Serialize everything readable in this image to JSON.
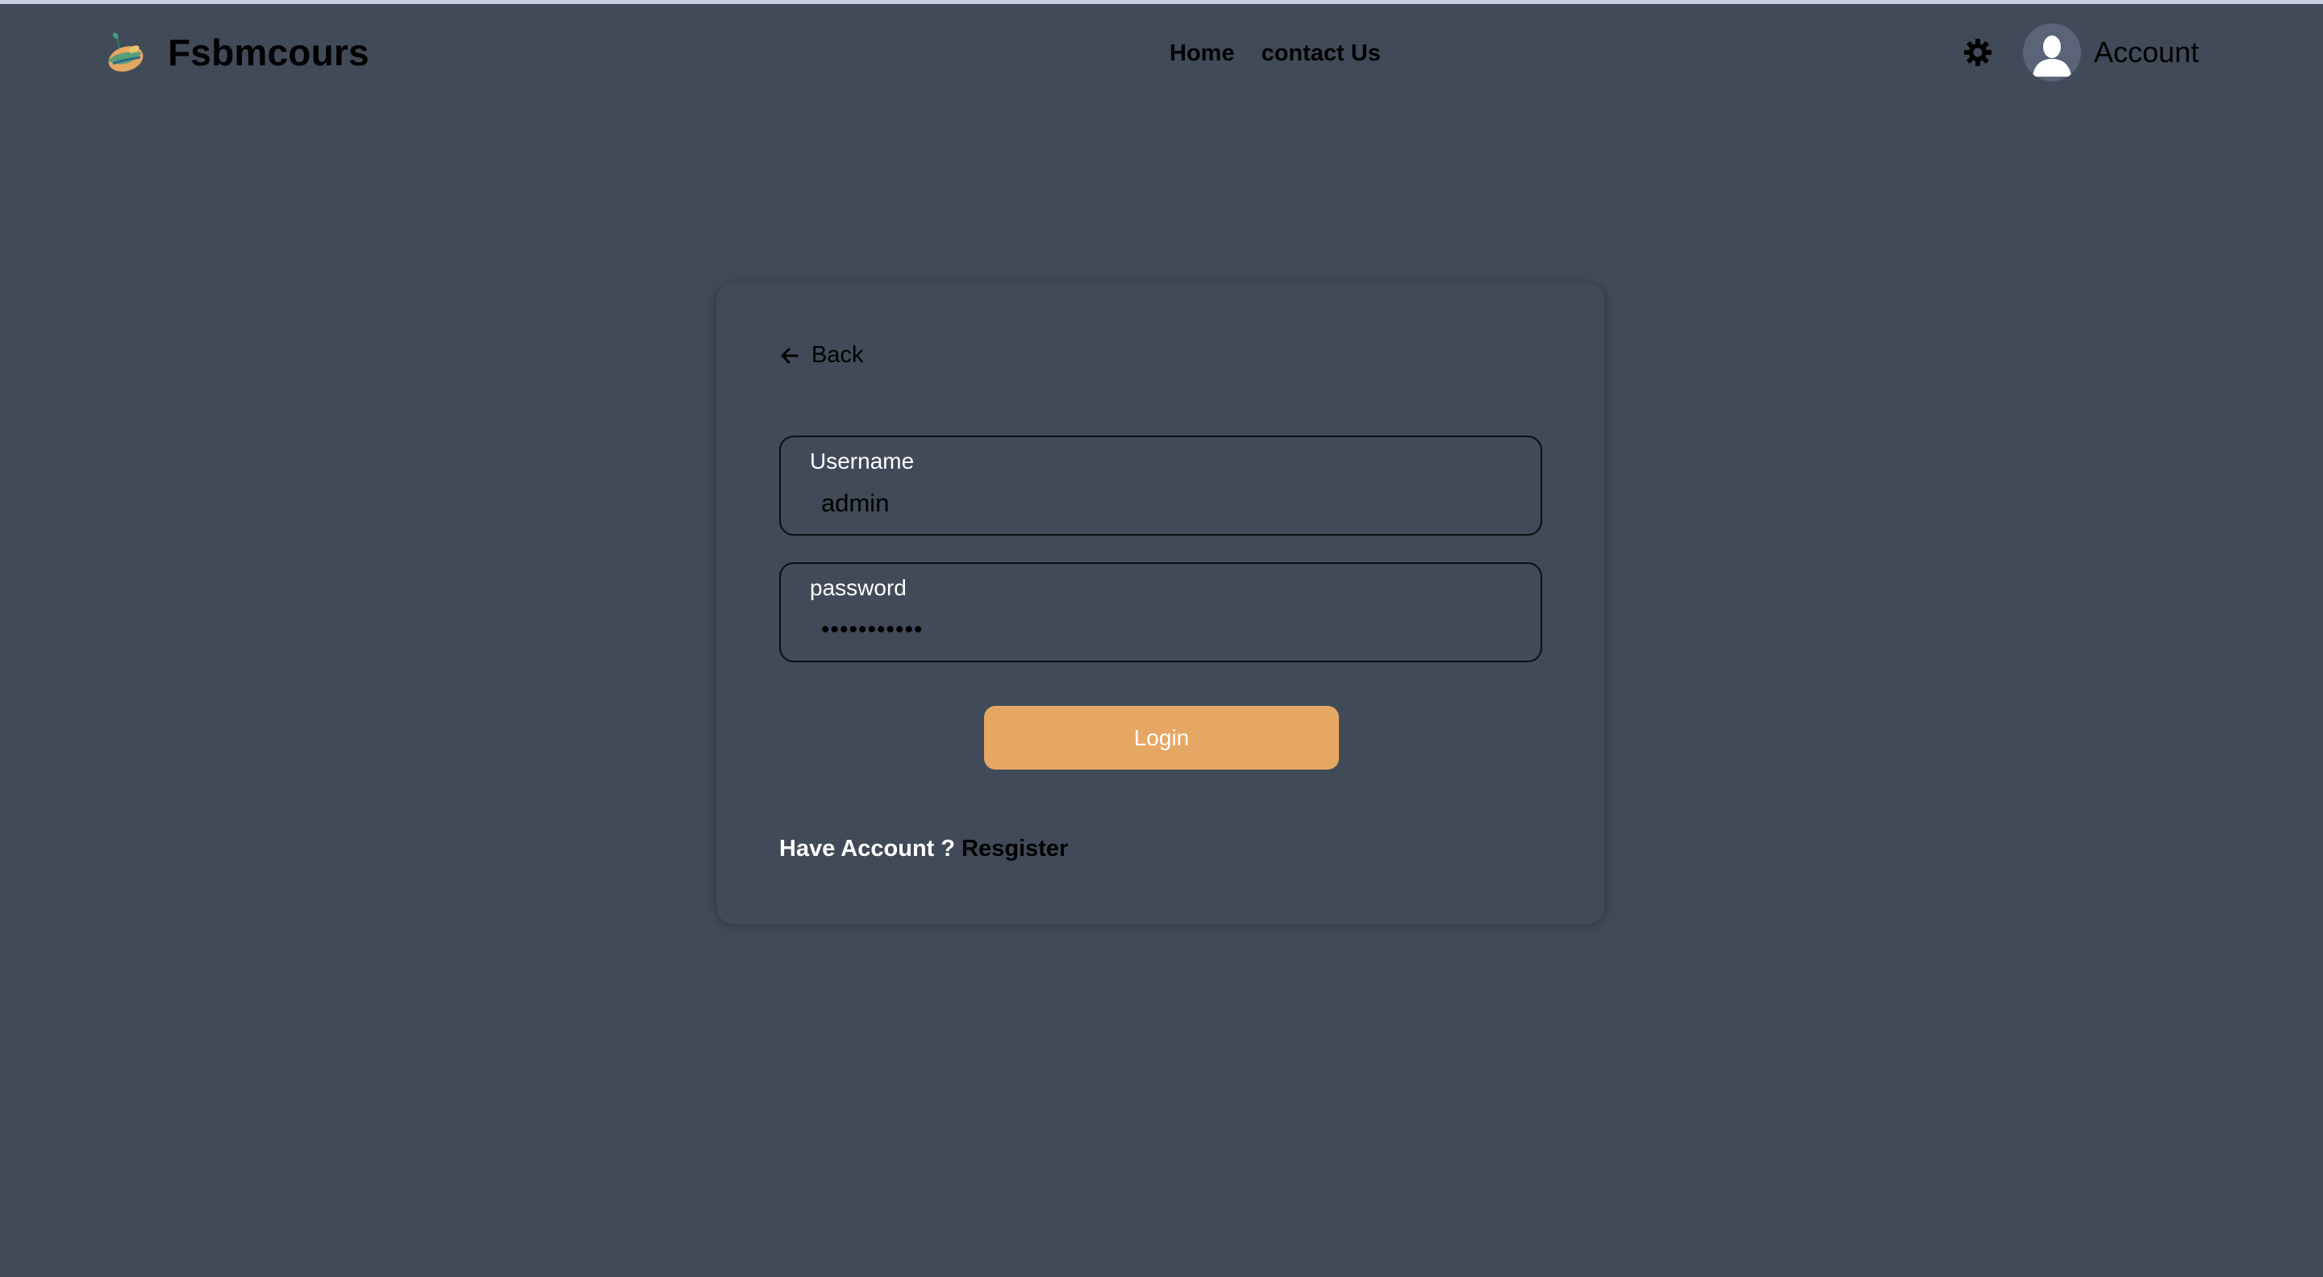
{
  "brand": {
    "name": "Fsbmcours",
    "logo_icon": "fruit-logo-icon"
  },
  "nav": {
    "items": [
      {
        "label": "Home"
      },
      {
        "label": "contact Us"
      }
    ]
  },
  "header": {
    "theme_icon": "gear-sun-icon",
    "account_label": "Account",
    "avatar_icon": "user-avatar-icon"
  },
  "login_form": {
    "back_label": "Back",
    "back_icon": "arrow-left-icon",
    "username": {
      "label": "Username",
      "value": "admin"
    },
    "password": {
      "label": "password",
      "value": "•••••••••••"
    },
    "submit_label": "Login",
    "footer_question": "Have Account ?",
    "register_link": "Resgister"
  },
  "colors": {
    "background": "#414a58",
    "accent": "#e7a764",
    "text_dark": "#000000",
    "text_light": "#ffffff"
  }
}
